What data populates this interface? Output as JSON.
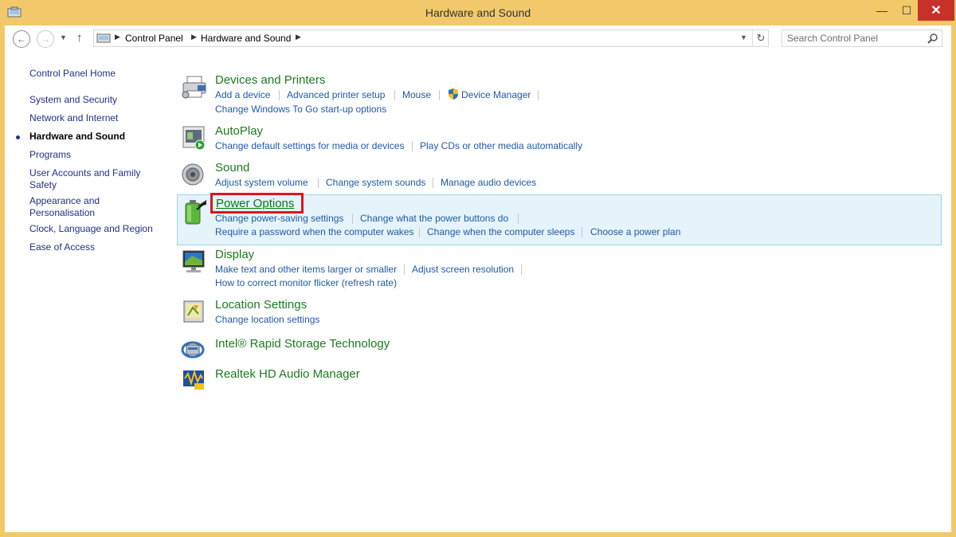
{
  "window": {
    "title": "Hardware and Sound",
    "min_glyph": "—",
    "max_glyph": "☐",
    "close_glyph": "✕"
  },
  "address": {
    "crumbs": [
      "Control Panel",
      "Hardware and Sound"
    ],
    "search_placeholder": "Search Control Panel"
  },
  "sidebar": {
    "items": [
      {
        "label": "Control Panel Home"
      },
      {
        "label": "System and Security"
      },
      {
        "label": "Network and Internet"
      },
      {
        "label": "Hardware and Sound",
        "active": true
      },
      {
        "label": "Programs"
      },
      {
        "label": "User Accounts and Family Safety"
      },
      {
        "label": "Appearance and Personalisation"
      },
      {
        "label": "Clock, Language and Region"
      },
      {
        "label": "Ease of Access"
      }
    ]
  },
  "categories": {
    "devices": {
      "title": "Devices and Printers",
      "links": [
        "Add a device",
        "Advanced printer setup",
        "Mouse",
        "Device Manager",
        "Change Windows To Go start-up options"
      ]
    },
    "autoplay": {
      "title": "AutoPlay",
      "links": [
        "Change default settings for media or devices",
        "Play CDs or other media automatically"
      ]
    },
    "sound": {
      "title": "Sound",
      "links": [
        "Adjust system volume",
        "Change system sounds",
        "Manage audio devices"
      ]
    },
    "power": {
      "title": "Power Options",
      "links": [
        "Change power-saving settings",
        "Change what the power buttons do",
        "Require a password when the computer wakes",
        "Change when the computer sleeps",
        "Choose a power plan"
      ]
    },
    "display": {
      "title": "Display",
      "links": [
        "Make text and other items larger or smaller",
        "Adjust screen resolution",
        "How to correct monitor flicker (refresh rate)"
      ]
    },
    "location": {
      "title": "Location Settings",
      "links": [
        "Change location settings"
      ]
    },
    "intel": {
      "title": "Intel® Rapid Storage Technology"
    },
    "realtek": {
      "title": "Realtek HD Audio Manager"
    }
  },
  "colors": {
    "frame": "#f1c96b",
    "category_title": "#1e7b1e",
    "link": "#1f5aa6",
    "highlight_bg": "#e5f3fb",
    "highlight_border": "#9ad3ed",
    "annotation_box": "#e0141e"
  },
  "icons": [
    "printer-icon",
    "autoplay-icon",
    "speaker-icon",
    "battery-icon",
    "monitor-icon",
    "location-icon",
    "storage-icon",
    "audio-manager-icon",
    "shield-icon",
    "search-icon"
  ]
}
